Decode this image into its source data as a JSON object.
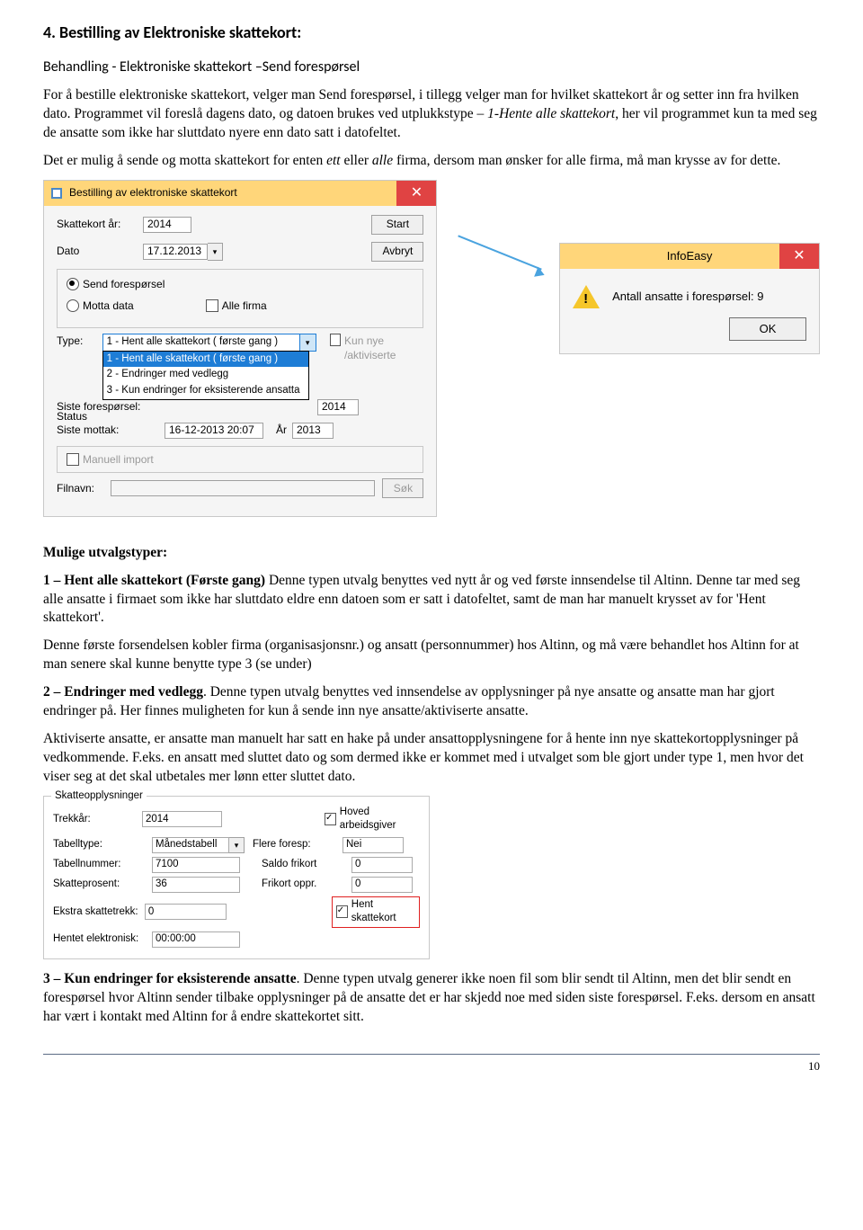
{
  "heading": "4. Bestilling av Elektroniske skattekort:",
  "subtitle": "Behandling - Elektroniske skattekort –Send forespørsel",
  "para1_a": "For å bestille elektroniske skattekort, velger man Send forespørsel, i tillegg velger man for hvilket skattekort år og setter inn fra hvilken dato. Programmet vil foreslå dagens dato, og datoen brukes ved utplukkstype – ",
  "para1_i": "1-Hente alle skattekort",
  "para1_b": ", her vil programmet kun ta med seg de ansatte som ikke har sluttdato nyere enn dato satt i datofeltet.",
  "para2_a": "Det er mulig å sende og motta skattekort for enten ",
  "para2_i1": "ett",
  "para2_mid": " eller ",
  "para2_i2": "alle",
  "para2_b": " firma, dersom man ønsker for alle firma, må man krysse av for dette.",
  "dlg1": {
    "title": "Bestilling av elektroniske skattekort",
    "year_label": "Skattekort år:",
    "year_val": "2014",
    "date_label": "Dato",
    "date_val": "17.12.2013",
    "start": "Start",
    "avbryt": "Avbryt",
    "r_send": "Send forespørsel",
    "r_motta": "Motta data",
    "alle_firma": "Alle firma",
    "type": "Type:",
    "kun_nye": "Kun nye /aktiviserte",
    "dd_sel": "1 - Hent alle skattekort ( første gang )",
    "dd1": "1 - Hent alle skattekort ( første gang )",
    "dd2": "2 - Endringer med vedlegg",
    "dd3": "3 - Kun endringer for eksisterende ansatta",
    "status": "Status",
    "siste_f": "Siste forespørsel:",
    "year2": "2014",
    "siste_m": "Siste mottak:",
    "siste_m_val": "16-12-2013 20:07",
    "year3": "2013",
    "ar": "År",
    "manuell": "Manuell import",
    "filnavn": "Filnavn:",
    "sok": "Søk"
  },
  "dlg2": {
    "title": "InfoEasy",
    "msg": "Antall ansatte i forespørsel: 9",
    "ok": "OK"
  },
  "mulig_head": "Mulige utvalgstyper:",
  "opt1_b": "1 – Hent alle skattekort (Første gang)",
  "opt1_t": " Denne typen utvalg benyttes ved nytt år og ved første innsendelse til Altinn. Denne tar med seg alle ansatte i firmaet som ikke har sluttdato eldre enn datoen som er satt i datofeltet, samt de man har manuelt krysset av for 'Hent skattekort'.",
  "opt1_p2": "Denne første forsendelsen kobler firma (organisasjonsnr.) og ansatt (personnummer) hos Altinn, og må være behandlet hos Altinn for at man senere skal kunne benytte type 3 (se under)",
  "opt2_b": "2 – Endringer med vedlegg",
  "opt2_t": ". Denne typen utvalg benyttes ved innsendelse av opplysninger på nye ansatte og ansatte man har gjort endringer på. Her finnes muligheten for kun å sende inn nye ansatte/aktiviserte ansatte.",
  "opt2_p2": "Aktiviserte ansatte, er ansatte man manuelt har satt en hake på under ansattopplysningene for å hente inn nye skattekortopplysninger på vedkommende. F.eks. en ansatt med sluttet dato og som dermed ikke er kommet med i utvalget som ble gjort under type 1, men hvor det viser seg at det skal utbetales mer lønn etter sluttet dato.",
  "panel": {
    "legend": "Skatteopplysninger",
    "trekk": "Trekkår:",
    "trekk_v": "2014",
    "hoved": "Hoved arbeidsgiver",
    "tabtype": "Tabelltype:",
    "tabtype_v": "Månedstabell",
    "flere": "Flere foresp:",
    "flere_v": "Nei",
    "tabnr": "Tabellnummer:",
    "tabnr_v": "7100",
    "saldo": "Saldo frikort",
    "saldo_v": "0",
    "skpros": "Skatteprosent:",
    "skpros_v": "36",
    "frikopp": "Frikort oppr.",
    "frikopp_v": "0",
    "ekstra": "Ekstra skattetrekk:",
    "ekstra_v": "0",
    "hent": "Hent skattekort",
    "hentet": "Hentet elektronisk:",
    "hentet_v": "00:00:00"
  },
  "opt3_b": "3 – Kun endringer for eksisterende ansatte",
  "opt3_t": ". Denne typen utvalg generer ikke noen fil som blir sendt til Altinn, men det blir sendt en forespørsel hvor Altinn sender tilbake opplysninger på de ansatte det er har skjedd noe med siden siste forespørsel. F.eks. dersom en ansatt har vært i kontakt med Altinn for å endre skattekortet sitt.",
  "pagenum": "10"
}
